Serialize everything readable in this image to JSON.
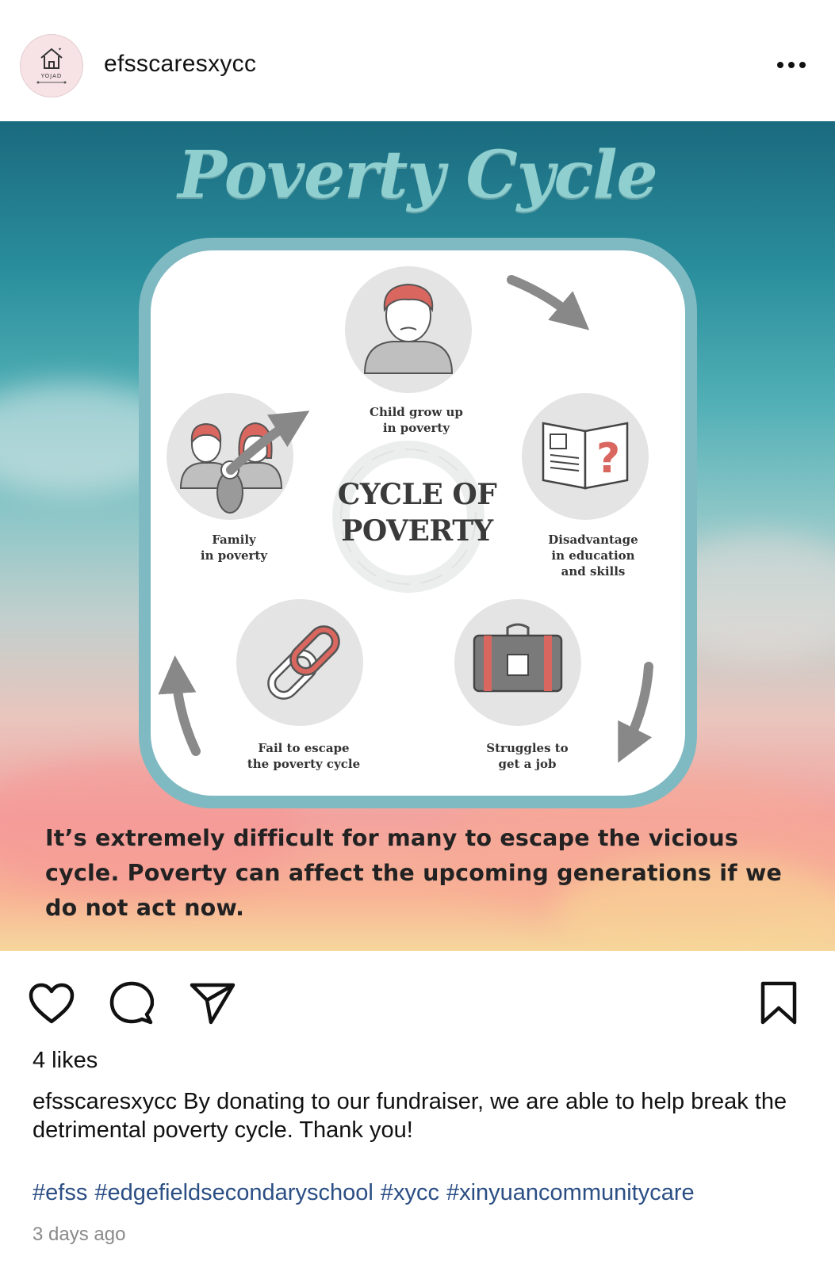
{
  "header": {
    "username": "efsscaresxycc",
    "avatar_text": "YOJAD",
    "more_icon": "more-horizontal-icon"
  },
  "poster": {
    "title": "Poverty Cycle",
    "center_title_line1": "CYCLE OF",
    "center_title_line2": "POVERTY",
    "nodes": [
      {
        "line1": "Child grow up",
        "line2": "in poverty",
        "line3": "",
        "icon": "sad-child-icon"
      },
      {
        "line1": "Disadvantage",
        "line2": "in education",
        "line3": "and skills",
        "icon": "open-book-question-icon"
      },
      {
        "line1": "Struggles to",
        "line2": "get a job",
        "line3": "",
        "icon": "briefcase-icon"
      },
      {
        "line1": "Fail to escape",
        "line2": "the poverty cycle",
        "line3": "",
        "icon": "chain-link-icon"
      },
      {
        "line1": "Family",
        "line2": "in poverty",
        "line3": "",
        "icon": "family-icon"
      }
    ],
    "caption": "It’s extremely difficult for many to escape the vicious cycle. Poverty can affect the upcoming generations if we do not act now.",
    "colors": {
      "accent_red": "#d9675f",
      "teal_border": "#7fb9c2",
      "title_teal": "#8fcfd0",
      "icon_grey": "#8a8a8a"
    }
  },
  "actions": {
    "like_icon": "heart-icon",
    "comment_icon": "comment-icon",
    "share_icon": "send-icon",
    "save_icon": "bookmark-icon"
  },
  "likes": "4 likes",
  "caption": {
    "username": "efsscaresxycc",
    "text": "By donating to our fundraiser, we are able to help break the detrimental poverty cycle. Thank you!"
  },
  "hashtags": [
    "#efss",
    "#edgefieldsecondaryschool",
    "#xycc",
    "#xinyuancommunitycare"
  ],
  "timestamp": "3 days ago"
}
